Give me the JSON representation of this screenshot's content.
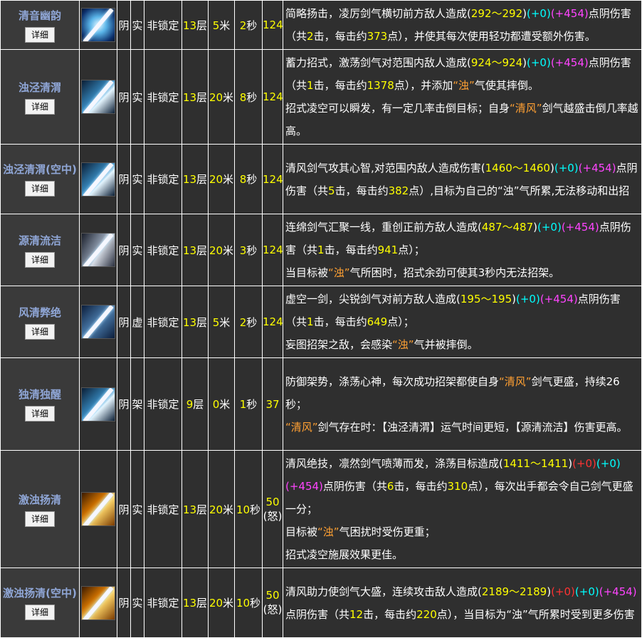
{
  "button_label": "详细",
  "rows": [
    {
      "name": "清音幽韵",
      "icon": "sword-blue-ring-icon",
      "c1": "阴",
      "c2": "实",
      "c3": "非锁定",
      "c4n": "13",
      "c4u": "层",
      "c5n": "5",
      "c5u": "米",
      "c6n": "2",
      "c6u": "秒",
      "c7": "124",
      "c7b": "",
      "desc": [
        [
          [
            "w",
            "简略扬击，凌厉剑气横切前方敌人造成("
          ],
          [
            "y",
            "292～292"
          ],
          [
            "w",
            ")"
          ],
          [
            "cy",
            "(+0)"
          ],
          [
            "m",
            "(+454)"
          ],
          [
            "w",
            "点阴伤害（共"
          ],
          [
            "y",
            "2"
          ],
          [
            "w",
            "击，每击约"
          ],
          [
            "y",
            "373"
          ],
          [
            "w",
            "点），并使其每次使用轻功都遭受额外伤害。"
          ]
        ]
      ]
    },
    {
      "name": "浊泾清渭",
      "icon": "sword-lightning-icon",
      "c1": "阴",
      "c2": "实",
      "c3": "非锁定",
      "c4n": "13",
      "c4u": "层",
      "c5n": "20",
      "c5u": "米",
      "c6n": "8",
      "c6u": "秒",
      "c7": "124",
      "c7b": "",
      "desc": [
        [
          [
            "w",
            "蓄力招式，激荡剑气对范围内敌人造成("
          ],
          [
            "y",
            "924～924"
          ],
          [
            "w",
            ")"
          ],
          [
            "cy",
            "(+0)"
          ],
          [
            "m",
            "(+454)"
          ],
          [
            "w",
            "点阴伤害（共"
          ],
          [
            "y",
            "1"
          ],
          [
            "w",
            "击，每击约"
          ],
          [
            "y",
            "1378"
          ],
          [
            "w",
            "点），并添加"
          ],
          [
            "o",
            "“浊”"
          ],
          [
            "w",
            "气使其摔倒。"
          ]
        ],
        [
          [
            "w",
            "招式凌空可以瞬发，有一定几率击倒目标；自身"
          ],
          [
            "o",
            "“清风”"
          ],
          [
            "w",
            "剑气越盛击倒几率越高。"
          ]
        ]
      ]
    },
    {
      "name": "浊泾清渭(空中)",
      "icon": "sword-lightning-icon",
      "c1": "阴",
      "c2": "实",
      "c3": "非锁定",
      "c4n": "13",
      "c4u": "层",
      "c5n": "20",
      "c5u": "米",
      "c6n": "8",
      "c6u": "秒",
      "c7": "124",
      "c7b": "",
      "desc": [
        [
          [
            "w",
            "清风剑气攻其心智,对范围内敌人造成伤害("
          ],
          [
            "y",
            "1460～1460"
          ],
          [
            "w",
            ")"
          ],
          [
            "cy",
            "(+0)"
          ],
          [
            "m",
            "(+454)"
          ],
          [
            "w",
            "点阴伤害（共"
          ],
          [
            "y",
            "5"
          ],
          [
            "w",
            "击，每击约"
          ],
          [
            "y",
            "382"
          ],
          [
            "w",
            "点）,目标为自己的“浊”气所累,无法移动和出招"
          ]
        ]
      ]
    },
    {
      "name": "源清流洁",
      "icon": "sword-steel-icon",
      "c1": "阴",
      "c2": "实",
      "c3": "非锁定",
      "c4n": "13",
      "c4u": "层",
      "c5n": "20",
      "c5u": "米",
      "c6n": "3",
      "c6u": "秒",
      "c7": "124",
      "c7b": "",
      "desc": [
        [
          [
            "w",
            "连绵剑气汇聚一线，重创正前方敌人造成("
          ],
          [
            "y",
            "487～487"
          ],
          [
            "w",
            ")"
          ],
          [
            "cy",
            "(+0)"
          ],
          [
            "m",
            "(+454)"
          ],
          [
            "w",
            "点阴伤害（共"
          ],
          [
            "y",
            "1"
          ],
          [
            "w",
            "击，每击约"
          ],
          [
            "y",
            "941"
          ],
          [
            "w",
            "点）；"
          ]
        ],
        [
          [
            "w",
            "当目标被"
          ],
          [
            "o",
            "“浊”"
          ],
          [
            "w",
            "气所困时，招式余劲可使其3秒内无法招架。"
          ]
        ]
      ]
    },
    {
      "name": "风清弊绝",
      "icon": "sword-figure-icon",
      "c1": "阴",
      "c2": "虚",
      "c3": "非锁定",
      "c4n": "13",
      "c4u": "层",
      "c5n": "5",
      "c5u": "米",
      "c6n": "2",
      "c6u": "秒",
      "c7": "124",
      "c7b": "",
      "desc": [
        [
          [
            "w",
            "虚空一剑，尖锐剑气对前方敌人造成("
          ],
          [
            "y",
            "195～195"
          ],
          [
            "w",
            ")"
          ],
          [
            "cy",
            "(+0)"
          ],
          [
            "m",
            "(+454)"
          ],
          [
            "w",
            "点阴伤害（共"
          ],
          [
            "y",
            "1"
          ],
          [
            "w",
            "击，每击约"
          ],
          [
            "y",
            "649"
          ],
          [
            "w",
            "点）；"
          ]
        ],
        [
          [
            "w",
            "妄图招架之敌，会感染"
          ],
          [
            "o",
            "“浊”"
          ],
          [
            "w",
            "气并被摔倒。"
          ]
        ]
      ]
    },
    {
      "name": "独清独醒",
      "icon": "parry-arms-icon",
      "c1": "阴",
      "c2": "架",
      "c3": "非锁定",
      "c4n": "9",
      "c4u": "层",
      "c5n": "0",
      "c5u": "米",
      "c6n": "1",
      "c6u": "秒",
      "c7": "37",
      "c7b": "",
      "desc": [
        [
          [
            "w",
            "防御架势，涤荡心神，每次成功招架都使自身"
          ],
          [
            "o",
            "“清风”"
          ],
          [
            "w",
            "剑气更盛，持续26秒；"
          ]
        ],
        [
          [
            "o",
            "“清风”"
          ],
          [
            "w",
            "剑气存在时：【浊泾清渭】运气时间更短，【源清流洁】伤害更高。"
          ]
        ]
      ]
    },
    {
      "name": "激浊扬清",
      "icon": "sword-golden-icon",
      "c1": "阴",
      "c2": "实",
      "c3": "非锁定",
      "c4n": "13",
      "c4u": "层",
      "c5n": "20",
      "c5u": "米",
      "c6n": "10",
      "c6u": "秒",
      "c7": "50",
      "c7b": "(怒)",
      "desc": [
        [
          [
            "w",
            "清风绝技，凛然剑气喷薄而发，涤荡目标造成("
          ],
          [
            "y",
            "1411～1411"
          ],
          [
            "w",
            ")"
          ],
          [
            "r",
            "(+0)"
          ],
          [
            "cy",
            "(+0)"
          ],
          [
            "m",
            "(+454)"
          ],
          [
            "w",
            "点阴伤害（共"
          ],
          [
            "y",
            "6"
          ],
          [
            "w",
            "击，每击约"
          ],
          [
            "y",
            "310"
          ],
          [
            "w",
            "点），每次出手都会令自己剑气更盛一分；"
          ]
        ],
        [
          [
            "w",
            "目标被"
          ],
          [
            "o",
            "“浊”"
          ],
          [
            "w",
            "气困扰时受伤更重；"
          ]
        ],
        [
          [
            "w",
            "招式凌空施展效果更佳。"
          ]
        ]
      ]
    },
    {
      "name": "激浊扬清(空中)",
      "icon": "sword-golden-icon",
      "c1": "阴",
      "c2": "实",
      "c3": "非锁定",
      "c4n": "13",
      "c4u": "层",
      "c5n": "20",
      "c5u": "米",
      "c6n": "10",
      "c6u": "秒",
      "c7": "50",
      "c7b": "(怒)",
      "desc": [
        [
          [
            "w",
            "清风助力使剑气大盛，连续攻击敌人造成("
          ],
          [
            "y",
            "2189～2189"
          ],
          [
            "w",
            ")"
          ],
          [
            "r",
            "(+0)"
          ],
          [
            "cy",
            "(+0)"
          ],
          [
            "m",
            "(+454)"
          ],
          [
            "w",
            "点阴伤害（共"
          ],
          [
            "y",
            "12"
          ],
          [
            "w",
            "击，每击约"
          ],
          [
            "y",
            "220"
          ],
          [
            "w",
            "点），当目标为“浊”气所累时受到更多伤害"
          ]
        ]
      ]
    }
  ]
}
